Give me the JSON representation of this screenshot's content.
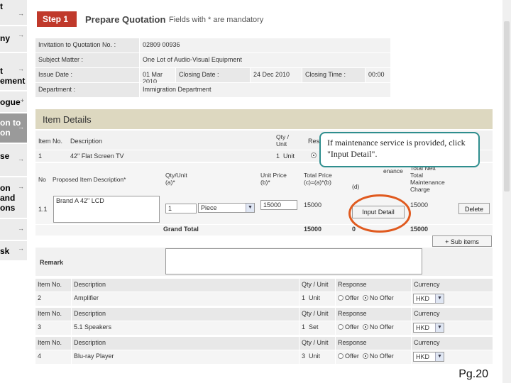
{
  "sidebar": {
    "items": [
      {
        "label": "t",
        "arrow": "→"
      },
      {
        "label": "ny",
        "arrow": "→"
      },
      {
        "label": "t\nement",
        "arrow": "→"
      },
      {
        "label": "ogue",
        "arrow": "+"
      },
      {
        "label": "on to\non",
        "arrow": "→"
      },
      {
        "label": "se",
        "arrow": "→"
      },
      {
        "label": "on\nand\nons",
        "arrow": "→"
      },
      {
        "label": "",
        "arrow": "→"
      },
      {
        "label": "sk",
        "arrow": "→"
      }
    ]
  },
  "header": {
    "step_label": "Step 1",
    "title": "Prepare Quotation",
    "note": "Fields with * are mandatory"
  },
  "info": {
    "itq_label": "Invitation to Quotation No. :",
    "itq_value": "02809 00936",
    "subject_label": "Subject Matter :",
    "subject_value": "One Lot of Audio-Visual Equipment",
    "issue_label": "Issue Date :",
    "issue_value": "01 Mar 2010",
    "closing_date_label": "Closing Date :",
    "closing_date_value": "24 Dec 2010",
    "closing_time_label": "Closing Time :",
    "closing_time_value": "00:00",
    "dept_label": "Department :",
    "dept_value": "Immigration Department"
  },
  "item_details": {
    "title": "Item Details",
    "h_item_no": "Item No.",
    "h_description": "Description",
    "h_qty_unit": "Qty /\nUnit",
    "h_response": "Res",
    "item1_no": "1",
    "item1_desc": "42\" Flat Screen TV",
    "item1_qty": "1  Unit",
    "sub": {
      "h_no": "No",
      "h_proposed": "Proposed Item Description*",
      "h_qty": "Qty/Unit\n(a)*",
      "h_unit_price": "Unit Price\n(b)*",
      "h_total_price": "Total Price\n(c)=(a)*(b)",
      "h_col_d": "(d)",
      "h_maint": "enance",
      "h_total_maint": "Total\nMaintenance\nCharge",
      "h_total_maint_top": "Total Nett",
      "row_no": "1.1",
      "proposed_value": "Brand A 42\" LCD",
      "qty_value": "1",
      "unit_value": "Piece",
      "unit_price_value": "15000",
      "total_price_value": "15000",
      "maint_value": "15000",
      "input_detail_btn": "Input Detail",
      "delete_btn": "Delete",
      "grand_total_label": "Grand Total",
      "grand_total_price": "15000",
      "grand_total_d": "0",
      "grand_total_maint": "15000",
      "add_sub_btn": "+ Sub items"
    },
    "remark_label": "Remark"
  },
  "other_items": [
    {
      "h_item_no": "Item No.",
      "h_desc": "Description",
      "h_qty": "Qty / Unit",
      "h_resp": "Response",
      "h_cur": "Currency",
      "no": "2",
      "desc": "Amplifier",
      "qty": "1  Unit",
      "offer": "Offer",
      "no_offer": "No Offer",
      "currency": "HKD"
    },
    {
      "h_item_no": "Item No.",
      "h_desc": "Description",
      "h_qty": "Qty / Unit",
      "h_resp": "Response",
      "h_cur": "Currency",
      "no": "3",
      "desc": "5.1 Speakers",
      "qty": "1  Set",
      "offer": "Offer",
      "no_offer": "No Offer",
      "currency": "HKD"
    },
    {
      "h_item_no": "Item No.",
      "h_desc": "Description",
      "h_qty": "Qty / Unit",
      "h_resp": "Response",
      "h_cur": "Currency",
      "no": "4",
      "desc": "Blu-ray Player",
      "qty": "3  Unit",
      "offer": "Offer",
      "no_offer": "No Offer",
      "currency": "HKD"
    }
  ],
  "callout": {
    "text": "If maintenance service is provided, click \"Input Detail\"."
  },
  "page_number": "Pg.20",
  "colors": {
    "step_red": "#c0392b",
    "callout_border": "#2f8e8e",
    "highlight_ring": "#e05a1f",
    "section_header": "#ddd8c0"
  }
}
